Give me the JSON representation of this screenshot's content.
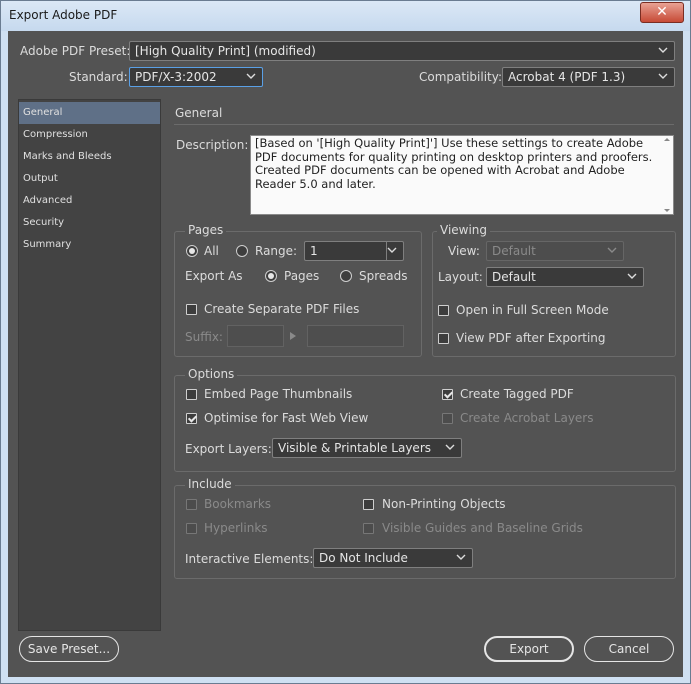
{
  "window": {
    "title": "Export Adobe PDF",
    "close_glyph": "✕"
  },
  "preset": {
    "label": "Adobe PDF Preset:",
    "value": "[High Quality Print] (modified)"
  },
  "standard": {
    "label": "Standard:",
    "value": "PDF/X-3:2002"
  },
  "compatibility": {
    "label": "Compatibility:",
    "value": "Acrobat 4 (PDF 1.3)"
  },
  "sidebar": {
    "items": [
      {
        "label": "General",
        "selected": true
      },
      {
        "label": "Compression"
      },
      {
        "label": "Marks and Bleeds"
      },
      {
        "label": "Output"
      },
      {
        "label": "Advanced"
      },
      {
        "label": "Security"
      },
      {
        "label": "Summary"
      }
    ]
  },
  "section_title": "General",
  "description": {
    "label": "Description:",
    "text": "[Based on '[High Quality Print]'] Use these settings to create Adobe PDF documents for quality printing on desktop printers and proofers. Created PDF documents can be opened with Acrobat and Adobe Reader 5.0 and later."
  },
  "pages": {
    "title": "Pages",
    "all_label": "All",
    "range_label": "Range:",
    "range_value": "1",
    "export_as_label": "Export As",
    "pages_label": "Pages",
    "spreads_label": "Spreads",
    "separate_label": "Create Separate PDF Files",
    "suffix_label": "Suffix:"
  },
  "viewing": {
    "title": "Viewing",
    "view_label": "View:",
    "view_value": "Default",
    "layout_label": "Layout:",
    "layout_value": "Default",
    "fullscreen_label": "Open in Full Screen Mode",
    "view_after_label": "View PDF after Exporting"
  },
  "options": {
    "title": "Options",
    "embed_thumbnails": "Embed Page Thumbnails",
    "optimise_web": "Optimise for Fast Web View",
    "tagged_pdf": "Create Tagged PDF",
    "acrobat_layers": "Create Acrobat Layers",
    "export_layers_label": "Export Layers:",
    "export_layers_value": "Visible & Printable Layers"
  },
  "include": {
    "title": "Include",
    "bookmarks": "Bookmarks",
    "hyperlinks": "Hyperlinks",
    "non_printing": "Non-Printing Objects",
    "guides": "Visible Guides and Baseline Grids",
    "interactive_label": "Interactive Elements:",
    "interactive_value": "Do Not Include"
  },
  "buttons": {
    "save_preset": "Save Preset...",
    "export": "Export",
    "cancel": "Cancel"
  },
  "icons": {
    "chevron": "chevron-down-icon",
    "close": "close-icon",
    "checkmark": "checkmark-icon"
  },
  "colors": {
    "panel": "#535353",
    "selection": "#5f7087",
    "focus": "#5aa0e6"
  }
}
